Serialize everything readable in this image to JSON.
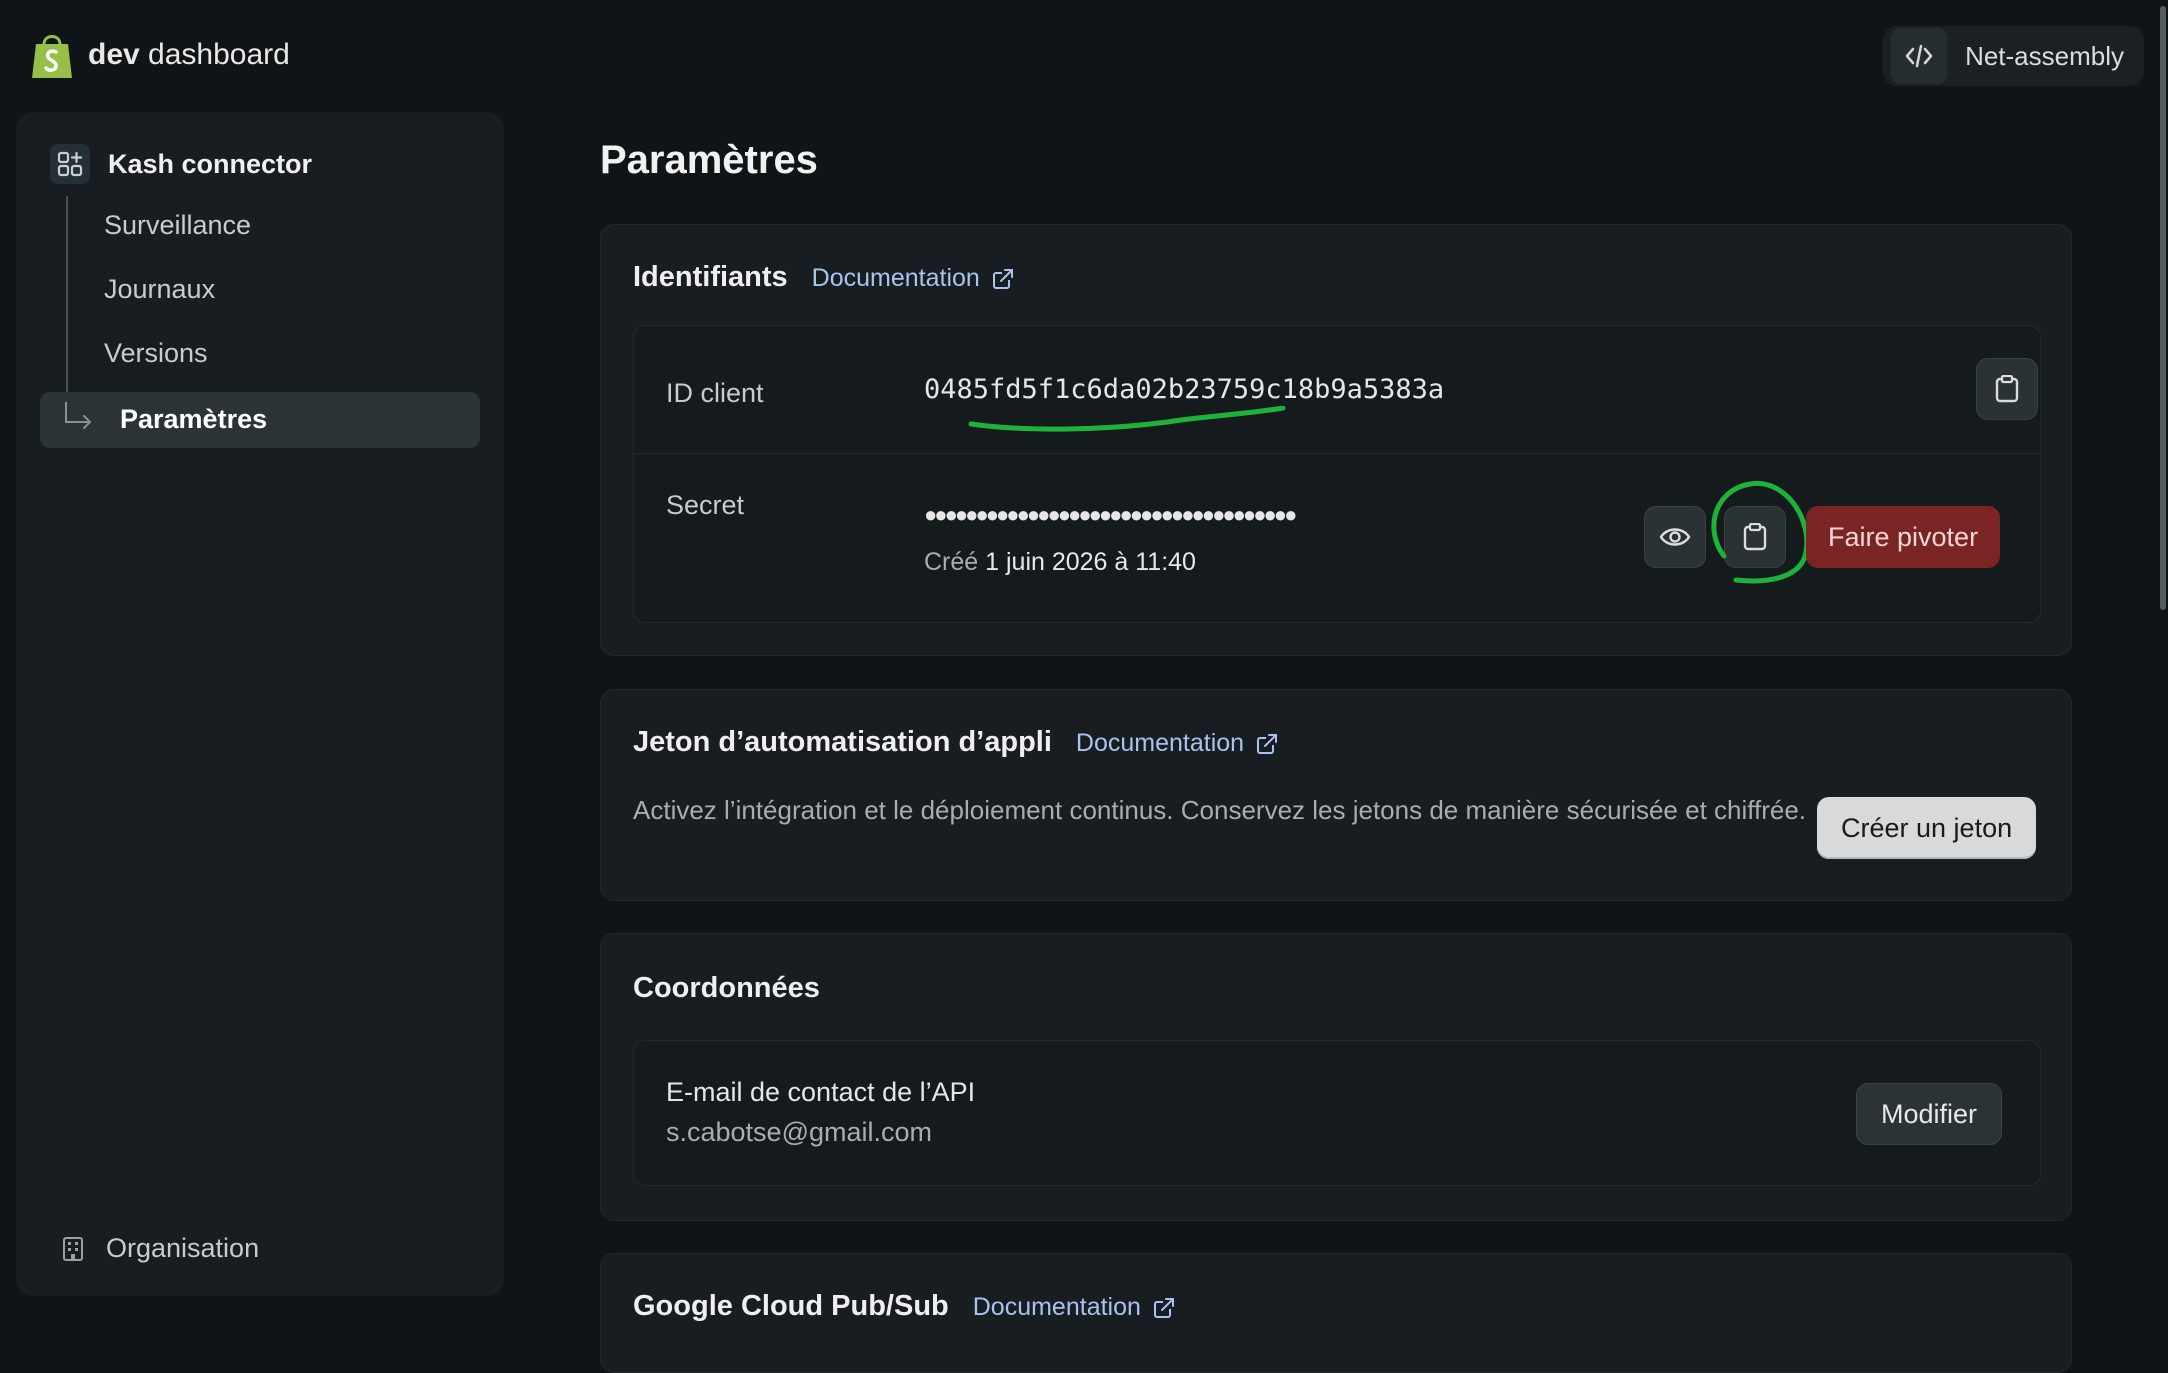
{
  "brand": {
    "bold": "dev",
    "rest": " dashboard",
    "color": "#95bf47"
  },
  "org_switcher": {
    "name": "Net-assembly",
    "icon": "code-icon"
  },
  "sidebar": {
    "app_name": "Kash connector",
    "items": [
      {
        "label": "Surveillance"
      },
      {
        "label": "Journaux"
      },
      {
        "label": "Versions"
      }
    ],
    "active_item": "Paramètres",
    "footer_label": "Organisation"
  },
  "page": {
    "title": "Paramètres"
  },
  "credentials": {
    "title": "Identifiants",
    "doc_label": "Documentation",
    "client_id_label": "ID client",
    "client_id_value": "0485fd5f1c6da02b23759c18b9a5383a",
    "secret_label": "Secret",
    "secret_masked": "●●●●●●●●●●●●●●●●●●●●●●●●●●●●●●●●●●●●",
    "created_prefix": "Créé",
    "created_date": " 1 juin 2026 à 11:40",
    "rotate_label": "Faire pivoter"
  },
  "automation_token": {
    "title": "Jeton d’automatisation d’appli",
    "doc_label": "Documentation",
    "description": "Activez l’intégration et le déploiement continus. Conservez les jetons de manière sécurisée et chiffrée.",
    "create_label": "Créer un jeton"
  },
  "contact": {
    "title": "Coordonnées",
    "email_label": "E-mail de contact de l’API",
    "email_value": "s.cabotse@gmail.com",
    "edit_label": "Modifier"
  },
  "pubsub": {
    "title": "Google Cloud Pub/Sub",
    "doc_label": "Documentation"
  }
}
